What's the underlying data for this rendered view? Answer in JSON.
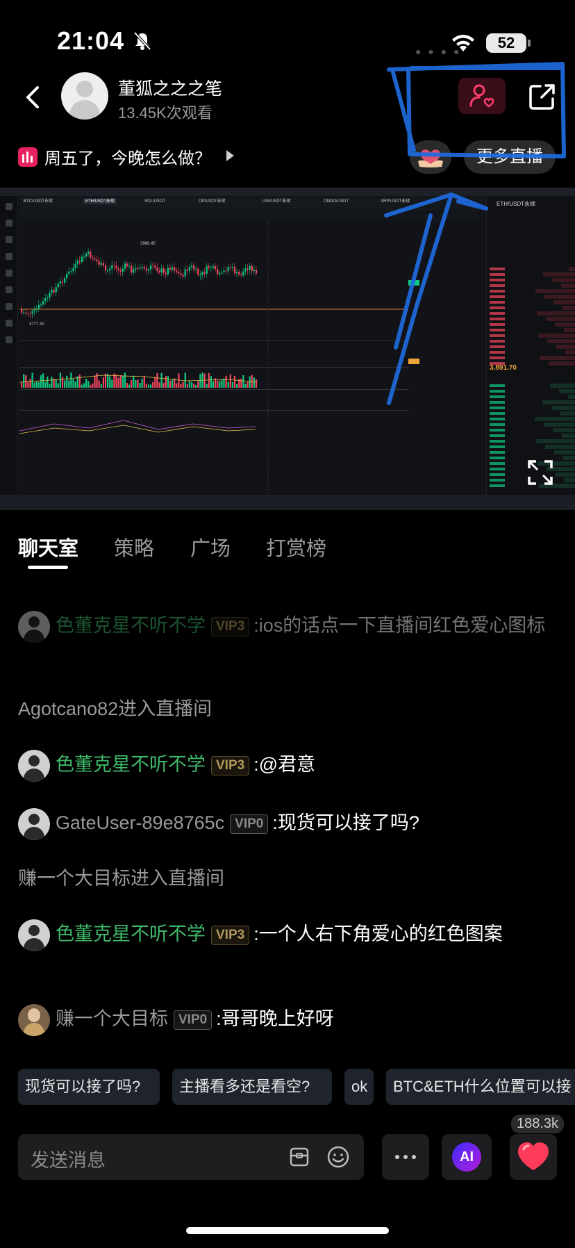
{
  "status_bar": {
    "time": "21:04",
    "battery": "52"
  },
  "header": {
    "host_name": "董狐之之之笔",
    "views": "13.45K次观看",
    "topic": "周五了，今晚怎么做？",
    "more_live": "更多直播"
  },
  "video": {
    "pairs": [
      "BTC/USDT永续",
      "ETH/USDT永续",
      "SOL/USDT",
      "OP/USDT永续",
      "UNI/USDT永续",
      "ONDO/USDT",
      "XRP/USDT永续"
    ],
    "orderbook_title": "ETH/USDT永续",
    "last_price": "3,891.70",
    "high_label": "3968.45",
    "low_label": "3777.40"
  },
  "tabs": [
    "聊天室",
    "策略",
    "广场",
    "打赏榜"
  ],
  "messages": [
    {
      "user": "色董克星不听不学",
      "vip": "VIP3",
      "text": ":ios的话点一下直播间红色爱心图标"
    },
    {
      "system": "Agotcano82进入直播间"
    },
    {
      "user": "色董克星不听不学",
      "vip": "VIP3",
      "text": ":@君意"
    },
    {
      "user": "GateUser-89e8765c",
      "vip": "VIP0",
      "text": ":现货可以接了吗?"
    },
    {
      "system": "赚一个大目标进入直播间"
    },
    {
      "user": "色董克星不听不学",
      "vip": "VIP3",
      "text": ":一个人右下角爱心的红色图案"
    },
    {
      "user": "赚一个大目标",
      "vip": "VIP0",
      "text": ":哥哥晚上好呀"
    }
  ],
  "quick_replies": [
    "现货可以接了吗?",
    "主播看多还是看空?",
    "ok",
    "BTC&ETH什么位置可以接"
  ],
  "input": {
    "placeholder": "发送消息"
  },
  "ai_label": "AI",
  "like_count": "188.3k",
  "colors": {
    "accent_pink": "#e8225e",
    "green_name": "#3fb86a",
    "vip_gold": "#b39a5c",
    "scribble_blue": "#1f6be0"
  }
}
